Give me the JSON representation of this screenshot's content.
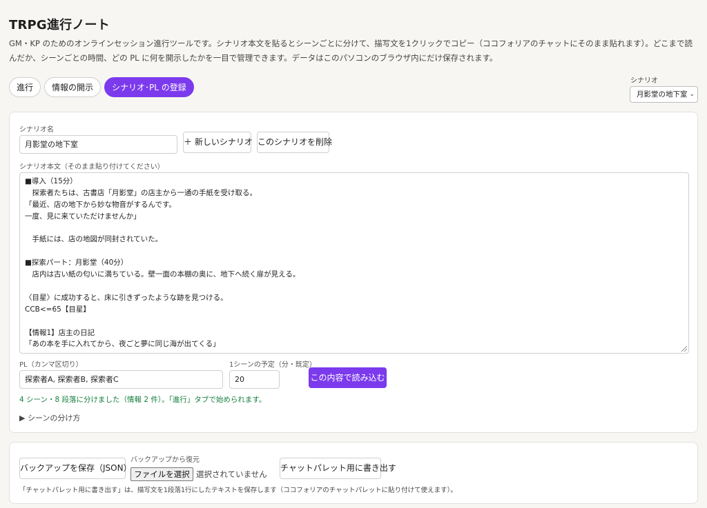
{
  "app": {
    "title": "TRPG進行ノート",
    "description": "GM・KP のためのオンラインセッション進行ツールです。シナリオ本文を貼るとシーンごとに分けて、描写文を1クリックでコピー（ココフォリアのチャットにそのまま貼れます）。どこまで読んだか、シーンごとの時間、どの PL に何を開示したかを一目で管理できます。データはこのパソコンのブラウザ内にだけ保存されます。"
  },
  "tabs": [
    {
      "label": "進行"
    },
    {
      "label": "情報の開示"
    },
    {
      "label": "シナリオ･PL の登録",
      "active": true
    }
  ],
  "scenario_select": {
    "label": "シナリオ",
    "value": "月影堂の地下室"
  },
  "editor": {
    "name_label": "シナリオ名",
    "name_value": "月影堂の地下室",
    "new_button": "＋ 新しいシナリオ",
    "delete_button": "このシナリオを削除",
    "body_label": "シナリオ本文（そのまま貼り付けてください）",
    "body_lines": [
      "■導入（15分）",
      "　探索者たちは、古書店「月影堂」の店主から一通の手紙を受け取る。",
      "「最近、店の地下から妙な物音がするんです。",
      "一度、見に来ていただけませんか」",
      "",
      "　手紙には、店の地図が同封されていた。",
      "",
      "■探索パート：月影堂（40分）",
      "　店内は古い紙の匂いに満ちている。壁一面の本棚の奥に、地下へ続く扉が見える。",
      "",
      "〈目星〉に成功すると、床に引きずったような跡を見つける。",
      "CCB<=65【目星】",
      "",
      "【情報1】店主の日記",
      "「あの本を手に入れてから、夜ごと夢に同じ海が出てくる」"
    ],
    "pl_label": "PL（カンマ区切り）",
    "pl_value": "探索者A, 探索者B, 探索者C",
    "time_label": "1シーンの予定（分・既定）",
    "time_value": "20",
    "load_button": "この内容で読み込む",
    "status": "4 シーン・8 段落に分けました（情報 2 件）。「進行」タブで始められます。",
    "disclosure": "▶ シーンの分け方"
  },
  "backup": {
    "save_button": "バックアップを保存（JSON）",
    "restore_label": "バックアップから復元",
    "file_button": "ファイルを選択",
    "file_status": "選択されていません",
    "export_button": "チャットパレット用に書き出す",
    "note": "「チャットパレット用に書き出す」は、描写文を1段落1行にしたテキストを保存します（ココフォリアのチャットパレットに貼り付けて使えます）。"
  },
  "colors": {
    "accent": "#7c3aed",
    "success": "#15803d"
  }
}
